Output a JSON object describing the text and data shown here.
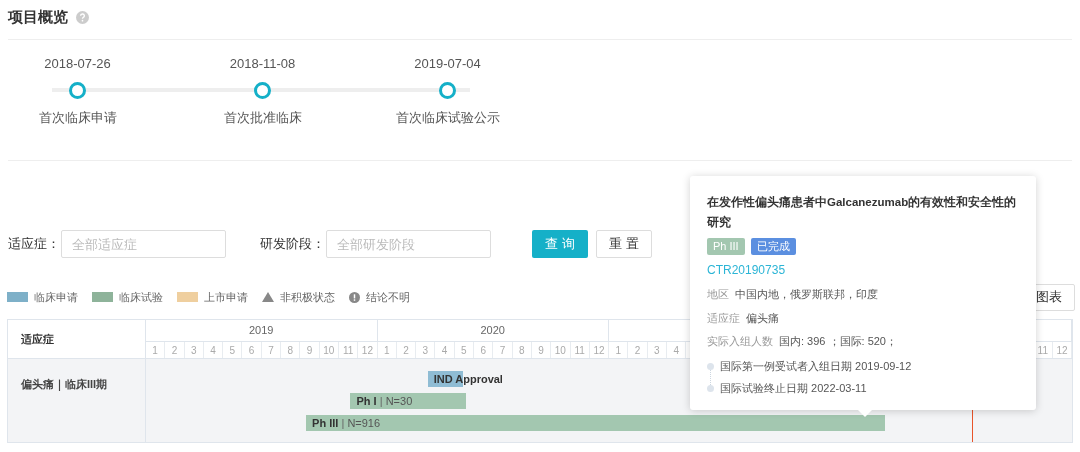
{
  "title": "项目概览",
  "milestones": [
    {
      "date": "2018-07-26",
      "label": "首次临床申请"
    },
    {
      "date": "2018-11-08",
      "label": "首次批准临床"
    },
    {
      "date": "2019-07-04",
      "label": "首次临床试验公示"
    }
  ],
  "filters": [
    {
      "label": "适应症：",
      "placeholder": "全部适应症"
    },
    {
      "label": "研发阶段：",
      "placeholder": "全部研发阶段"
    }
  ],
  "buttons": [
    {
      "label": "查 询",
      "kind": "primary"
    },
    {
      "label": "重 置",
      "kind": "default"
    }
  ],
  "legend": [
    {
      "kind": "swatch",
      "label": "临床申请",
      "color": "#7eb0c8"
    },
    {
      "kind": "swatch",
      "label": "临床试验",
      "color": "#8eb39a"
    },
    {
      "kind": "swatch",
      "label": "上市申请",
      "color": "#efcf9f"
    },
    {
      "kind": "triangle",
      "label": "非积极状态"
    },
    {
      "kind": "alert",
      "label": "结论不明"
    }
  ],
  "chart_button": "图表",
  "table": {
    "header": "适应症",
    "years": [
      {
        "label": "2019",
        "months": [
          "1",
          "2",
          "3",
          "4",
          "5",
          "6",
          "7",
          "8",
          "9",
          "10",
          "11",
          "12"
        ]
      },
      {
        "label": "2020",
        "months": [
          "1",
          "2",
          "3",
          "4",
          "5",
          "6",
          "7",
          "8",
          "9",
          "10",
          "11",
          "12"
        ]
      },
      {
        "months": [
          "1",
          "2",
          "3",
          "4"
        ]
      },
      {
        "months_tail": [
          "11",
          "12"
        ]
      }
    ],
    "rows": [
      {
        "indication": "偏头痛｜临床III期",
        "bars": [
          {
            "kind": "application",
            "name": "IND Approval"
          },
          {
            "kind": "trial",
            "name": "Ph I",
            "separator": "|",
            "detail": "N=30"
          },
          {
            "kind": "trial",
            "name": "Ph III",
            "separator": "|",
            "detail": "N=916"
          }
        ]
      }
    ]
  },
  "tooltip": {
    "title": "在发作性偏头痛患者中Galcanezumab的有效性和安全性的研究",
    "tags": [
      {
        "label": "Ph III",
        "color": "#a3c7b0"
      },
      {
        "label": "已完成",
        "color": "#5b8fe0"
      }
    ],
    "id": "CTR20190735",
    "fields": [
      {
        "label": "地区",
        "value": "中国内地，俄罗斯联邦，印度"
      },
      {
        "label": "适应症",
        "value": "偏头痛"
      },
      {
        "label": "实际入组人数",
        "value": "国内: 396 ；国际: 520；"
      }
    ],
    "events": [
      {
        "label": "国际第一例受试者入组日期 2019-09-12"
      },
      {
        "label": "国际试验终止日期 2022-03-11"
      }
    ]
  }
}
